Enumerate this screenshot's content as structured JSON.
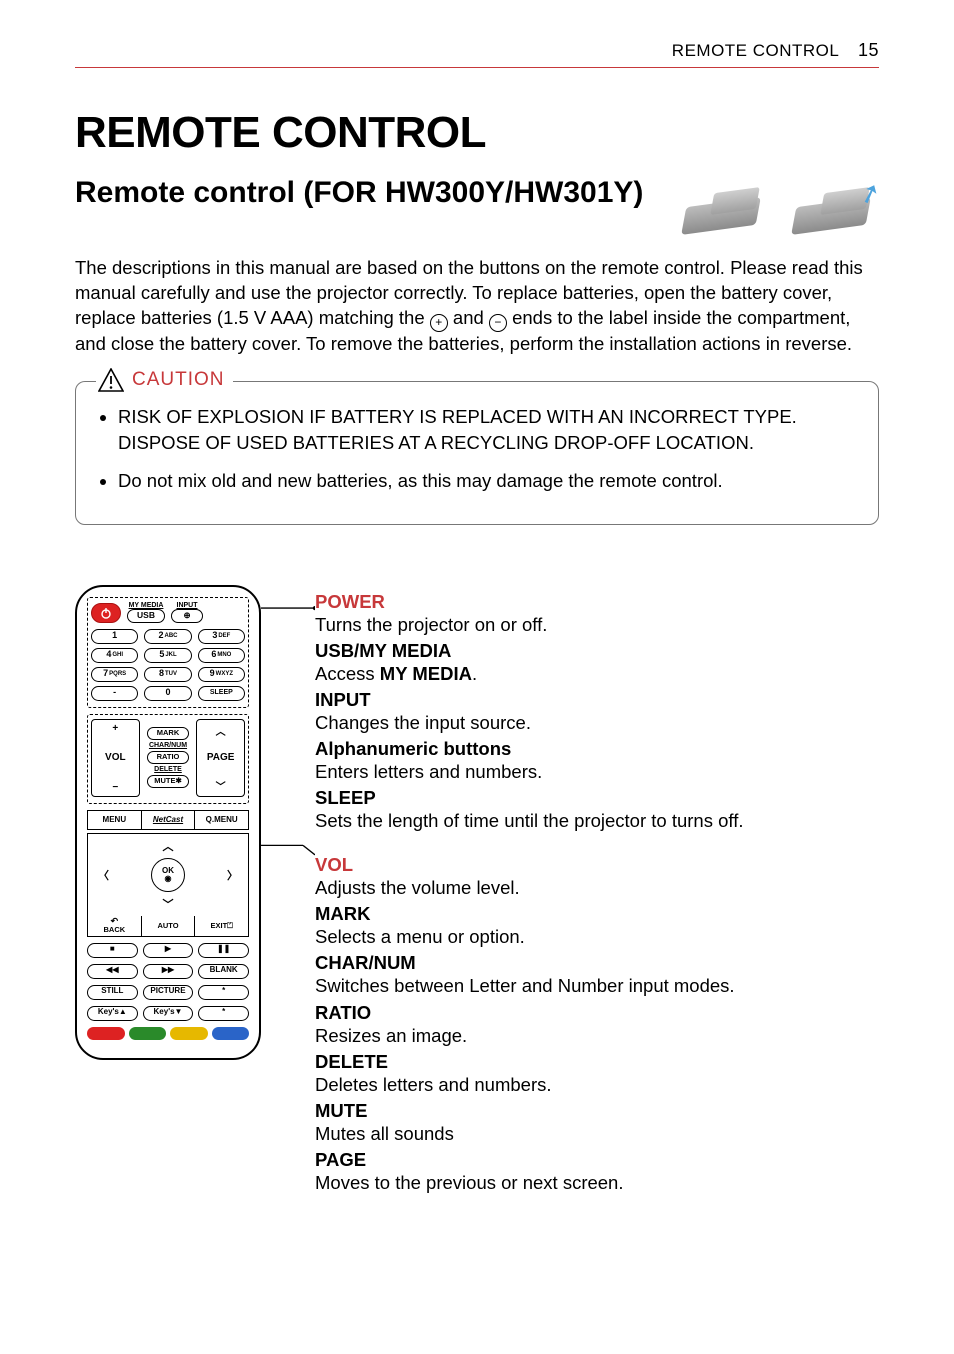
{
  "header": {
    "section": "REMOTE CONTROL",
    "page": "15"
  },
  "title": "REMOTE CONTROL",
  "subtitle": "Remote control (FOR HW300Y/HW301Y)",
  "intro": {
    "t1": "The descriptions in this manual are based on the buttons on the remote control. Please read this manual carefully and use the projector correctly. To replace batteries, open the battery cover, replace batteries (1.5 V AAA) matching the ",
    "t2": " and ",
    "t3": " ends to the label inside the compartment, and close the battery cover. To remove the batteries, perform the installation actions in reverse."
  },
  "caution": {
    "label": "CAUTION",
    "items": [
      "RISK OF EXPLOSION IF BATTERY IS REPLACED WITH AN INCORRECT TYPE. DISPOSE OF USED BATTERIES AT A RECYCLING DROP-OFF LOCATION.",
      "Do not mix old and new batteries, as this may damage the remote control."
    ]
  },
  "remote": {
    "labels": {
      "mymedia": "MY MEDIA",
      "usb": "USB",
      "input_lbl": "INPUT",
      "vol": "VOL",
      "page": "PAGE",
      "mark": "MARK",
      "charnum": "CHAR/NUM",
      "ratio": "RATIO",
      "delete": "DELETE",
      "mute": "MUTE✱",
      "menu": "MENU",
      "netcast": "NetCast",
      "qmenu": "Q.MENU",
      "ok": "OK",
      "back": "BACK",
      "auto": "AUTO",
      "exit": "EXIT⏍",
      "blank": "BLANK",
      "still": "STILL",
      "picture": "PICTURE",
      "keysup": "Key's▲",
      "keysdn": "Key's▼"
    },
    "keys": [
      {
        "n": "1",
        "l": ""
      },
      {
        "n": "2",
        "l": "ABC"
      },
      {
        "n": "3",
        "l": "DEF"
      },
      {
        "n": "4",
        "l": "GHI"
      },
      {
        "n": "5",
        "l": "JKL"
      },
      {
        "n": "6",
        "l": "MNO"
      },
      {
        "n": "7",
        "l": "PQRS"
      },
      {
        "n": "8",
        "l": "TUV"
      },
      {
        "n": "9",
        "l": "WXYZ"
      },
      {
        "n": "-",
        "l": ""
      },
      {
        "n": "0",
        "l": ""
      },
      {
        "n": "SLEEP",
        "l": ""
      }
    ],
    "media": {
      "stop": "■",
      "play": "▶",
      "pause": "❚❚",
      "rew": "◀◀",
      "ffwd": "▶▶"
    },
    "colors": [
      "#d22",
      "#2a8a2a",
      "#e6b800",
      "#2a64c8"
    ]
  },
  "descriptions": {
    "group1": [
      {
        "term": "POWER",
        "red": true,
        "def": "Turns the projector on or off."
      },
      {
        "term": "USB/MY MEDIA",
        "def_pre": "Access ",
        "def_bold": "MY MEDIA",
        "def_post": "."
      },
      {
        "term": "INPUT",
        "def": "Changes the input source."
      },
      {
        "term": "Alphanumeric buttons",
        "def": "Enters letters and numbers."
      },
      {
        "term": "SLEEP",
        "def": "Sets the length of time until the projector to turns off."
      }
    ],
    "group2": [
      {
        "term": "VOL",
        "red": true,
        "def": "Adjusts the volume level."
      },
      {
        "term": "MARK",
        "def": "Selects a menu or option."
      },
      {
        "term": "CHAR/NUM",
        "def": "Switches between Letter and Number input modes."
      },
      {
        "term": "RATIO",
        "def": "Resizes an image."
      },
      {
        "term": "DELETE",
        "def": "Deletes letters and numbers."
      },
      {
        "term": "MUTE",
        "def": "Mutes all sounds"
      },
      {
        "term": "PAGE",
        "def": "Moves to the previous or next screen."
      }
    ]
  }
}
